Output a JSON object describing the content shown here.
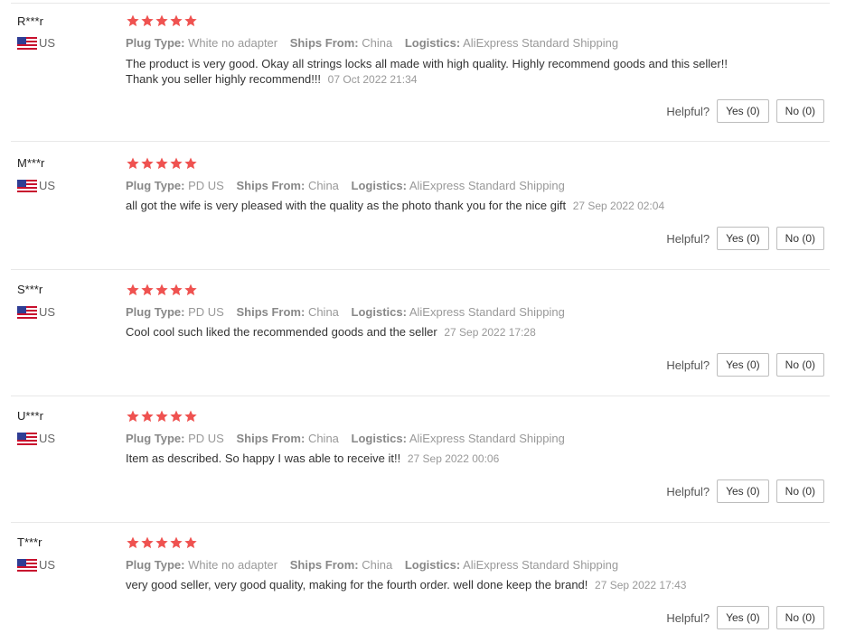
{
  "labels": {
    "plug_type": "Plug Type:",
    "ships_from": "Ships From:",
    "logistics": "Logistics:",
    "helpful": "Helpful?"
  },
  "colors": {
    "star": "#ef5250",
    "flag_red": "#c8102e",
    "flag_blue": "#2f3d94"
  },
  "reviews": [
    {
      "user": "R***r",
      "country": "US",
      "stars": 5,
      "plug_type": "White no adapter",
      "ships_from": "China",
      "logistics": "AliExpress Standard Shipping",
      "text": "The product is very good. Okay all strings locks all made with high quality. Highly recommend goods and this seller!! Thank you seller highly recommend!!!",
      "date": "07 Oct 2022 21:34",
      "yes": "Yes (0)",
      "no": "No (0)"
    },
    {
      "user": "M***r",
      "country": "US",
      "stars": 5,
      "plug_type": "PD US",
      "ships_from": "China",
      "logistics": "AliExpress Standard Shipping",
      "text": "all got the wife is very pleased with the quality as the photo thank you for the nice gift",
      "date": "27 Sep 2022 02:04",
      "yes": "Yes (0)",
      "no": "No (0)"
    },
    {
      "user": "S***r",
      "country": "US",
      "stars": 5,
      "plug_type": "PD US",
      "ships_from": "China",
      "logistics": "AliExpress Standard Shipping",
      "text": "Cool cool such liked the recommended goods and the seller",
      "date": "27 Sep 2022 17:28",
      "yes": "Yes (0)",
      "no": "No (0)"
    },
    {
      "user": "U***r",
      "country": "US",
      "stars": 5,
      "plug_type": "PD US",
      "ships_from": "China",
      "logistics": "AliExpress Standard Shipping",
      "text": "Item as described. So happy I was able to receive it!!",
      "date": "27 Sep 2022 00:06",
      "yes": "Yes (0)",
      "no": "No (0)"
    },
    {
      "user": "T***r",
      "country": "US",
      "stars": 5,
      "plug_type": "White no adapter",
      "ships_from": "China",
      "logistics": "AliExpress Standard Shipping",
      "text": "very good seller, very good quality, making for the fourth order. well done keep the brand!",
      "date": "27 Sep 2022 17:43",
      "yes": "Yes (0)",
      "no": "No (0)"
    }
  ]
}
